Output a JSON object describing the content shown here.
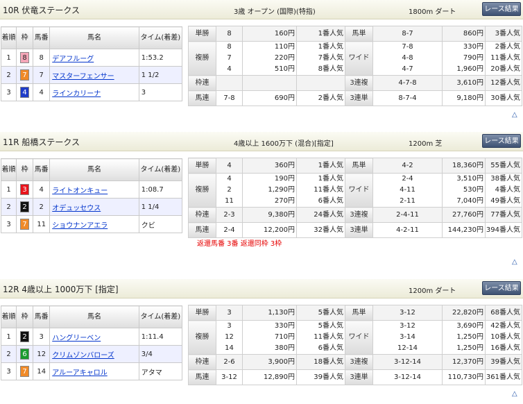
{
  "race_button_label": "レース結果",
  "triangle": "△",
  "result_headers": {
    "rank": "着順",
    "waku": "枠",
    "umaban": "馬番",
    "name": "馬名",
    "time": "タイム(着差)"
  },
  "pay_labels": {
    "tansho": "単勝",
    "fukusho": "複勝",
    "wakuren": "枠連",
    "umaren": "馬連",
    "umatan": "馬単",
    "wide": "ワイド",
    "sanrenpuku": "3連複",
    "sanrentan": "3連単"
  },
  "races": [
    {
      "title": "10R 伏竜ステークス",
      "cond": "3歳 オープン (国際)(特指)",
      "dist": "1800m ダート",
      "results": [
        {
          "rank": "1",
          "waku": "8",
          "umaban": "8",
          "name": "デアフルーグ",
          "time": "1:53.2"
        },
        {
          "rank": "2",
          "waku": "7",
          "umaban": "7",
          "name": "マスターフェンサー",
          "time": "1 1/2"
        },
        {
          "rank": "3",
          "waku": "4",
          "umaban": "4",
          "name": "ラインカリーナ",
          "time": "3"
        }
      ],
      "pay": {
        "tansho": [
          [
            "8",
            "160円",
            "1番人気"
          ]
        ],
        "fukusho": [
          [
            "8",
            "110円",
            "1番人気"
          ],
          [
            "7",
            "220円",
            "7番人気"
          ],
          [
            "4",
            "510円",
            "8番人気"
          ]
        ],
        "wakuren": [
          [
            "",
            "",
            ""
          ]
        ],
        "umaren": [
          [
            "7-8",
            "690円",
            "2番人気"
          ]
        ],
        "umatan": [
          [
            "8-7",
            "860円",
            "3番人気"
          ]
        ],
        "wide": [
          [
            "7-8",
            "330円",
            "2番人気"
          ],
          [
            "4-8",
            "790円",
            "11番人気"
          ],
          [
            "4-7",
            "1,960円",
            "20番人気"
          ]
        ],
        "sanrenpuku": [
          [
            "4-7-8",
            "3,610円",
            "12番人気"
          ]
        ],
        "sanrentan": [
          [
            "8-7-4",
            "9,180円",
            "30番人気"
          ]
        ]
      }
    },
    {
      "title": "11R 船橋ステークス",
      "cond": "4歳以上 1600万下 (混合)[指定]",
      "dist": "1200m 芝",
      "results": [
        {
          "rank": "1",
          "waku": "3",
          "umaban": "4",
          "name": "ライトオンキュー",
          "time": "1:08.7"
        },
        {
          "rank": "2",
          "waku": "2",
          "umaban": "2",
          "name": "オデュッセウス",
          "time": "1 1/4"
        },
        {
          "rank": "3",
          "waku": "7",
          "umaban": "11",
          "name": "ショウナンアエラ",
          "time": "クビ"
        }
      ],
      "pay": {
        "tansho": [
          [
            "4",
            "360円",
            "1番人気"
          ]
        ],
        "fukusho": [
          [
            "4",
            "190円",
            "1番人気"
          ],
          [
            "2",
            "1,290円",
            "11番人気"
          ],
          [
            "11",
            "270円",
            "6番人気"
          ]
        ],
        "wakuren": [
          [
            "2-3",
            "9,380円",
            "24番人気"
          ]
        ],
        "umaren": [
          [
            "2-4",
            "12,200円",
            "32番人気"
          ]
        ],
        "umatan": [
          [
            "4-2",
            "18,360円",
            "55番人気"
          ]
        ],
        "wide": [
          [
            "2-4",
            "3,510円",
            "38番人気"
          ],
          [
            "4-11",
            "530円",
            "4番人気"
          ],
          [
            "2-11",
            "7,040円",
            "49番人気"
          ]
        ],
        "sanrenpuku": [
          [
            "2-4-11",
            "27,760円",
            "77番人気"
          ]
        ],
        "sanrentan": [
          [
            "4-2-11",
            "144,230円",
            "394番人気"
          ]
        ]
      },
      "note": "返還馬番 3番 返還同枠 3枠"
    },
    {
      "title": "12R 4歳以上 1000万下 [指定]",
      "cond": "",
      "dist": "1200m ダート",
      "results": [
        {
          "rank": "1",
          "waku": "2",
          "umaban": "3",
          "name": "ハングリーベン",
          "time": "1:11.4"
        },
        {
          "rank": "2",
          "waku": "6",
          "umaban": "12",
          "name": "クリムゾンバローズ",
          "time": "3/4"
        },
        {
          "rank": "3",
          "waku": "7",
          "umaban": "14",
          "name": "アルーアキャロル",
          "time": "アタマ"
        }
      ],
      "pay": {
        "tansho": [
          [
            "3",
            "1,130円",
            "5番人気"
          ]
        ],
        "fukusho": [
          [
            "3",
            "330円",
            "5番人気"
          ],
          [
            "12",
            "710円",
            "11番人気"
          ],
          [
            "14",
            "380円",
            "6番人気"
          ]
        ],
        "wakuren": [
          [
            "2-6",
            "3,900円",
            "18番人気"
          ]
        ],
        "umaren": [
          [
            "3-12",
            "12,890円",
            "39番人気"
          ]
        ],
        "umatan": [
          [
            "3-12",
            "22,820円",
            "68番人気"
          ]
        ],
        "wide": [
          [
            "3-12",
            "3,690円",
            "42番人気"
          ],
          [
            "3-14",
            "1,250円",
            "10番人気"
          ],
          [
            "12-14",
            "1,250円",
            "16番人気"
          ]
        ],
        "sanrenpuku": [
          [
            "3-12-14",
            "12,370円",
            "39番人気"
          ]
        ],
        "sanrentan": [
          [
            "3-12-14",
            "110,730円",
            "361番人気"
          ]
        ]
      }
    }
  ],
  "waku_colors": {
    "1": "#ffffff",
    "2": "#111111",
    "3": "#e8141c",
    "4": "#1e3cc8",
    "5": "#f2e600",
    "6": "#1a9a2e",
    "7": "#f08a28",
    "8": "#f4a6b8"
  }
}
